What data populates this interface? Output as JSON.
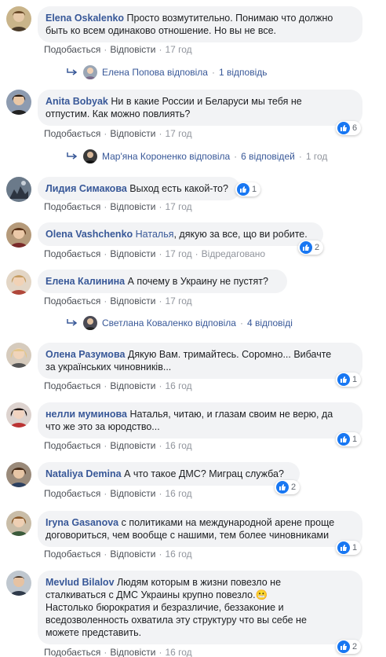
{
  "labels": {
    "like": "Подобається",
    "reply": "Відповісти",
    "edited": "Відредаговано"
  },
  "colors": {
    "link": "#385898",
    "bubble": "#f2f3f5",
    "like_badge": "#1877f2"
  },
  "comments": [
    {
      "author": "Elena Oskalenko",
      "lines": [
        "Просто возмутительно. Понимаю что должно",
        "быть ко всем одинаково отношение. Но вы не все."
      ],
      "time": "17 год",
      "avatar": "avatar-elena-oskalenko"
    },
    {
      "author": "Anita Bobyak",
      "lines": [
        "Ни в какие России и Беларуси мы тебя не",
        "отпустим. Как можно повлиять?"
      ],
      "time": "17 год",
      "reactions": "6",
      "avatar": "avatar-anita-bobyak"
    },
    {
      "author": "Лидия Симакова",
      "lines": [
        "Выход есть какой-то?"
      ],
      "time": "17 год",
      "reactions": "1",
      "avatar": "avatar-lidiya-simakova"
    },
    {
      "author": "Olena Vashchenko",
      "tag": "Наталья",
      "lines": [
        ", дякую за все, що ви робите."
      ],
      "time": "17 год",
      "edited": true,
      "reactions": "2",
      "avatar": "avatar-olena-vashchenko"
    },
    {
      "author": "Елена Калинина",
      "lines": [
        "А почему в Украину не пустят?"
      ],
      "time": "17 год",
      "avatar": "avatar-elena-kalinina"
    },
    {
      "author": "Олена Разумова",
      "lines": [
        "Дякую Вам. тримайтесь. Соромно... Вибачте",
        "за українських чиновників..."
      ],
      "time": "16 год",
      "reactions": "1",
      "avatar": "avatar-olena-razumova"
    },
    {
      "author": "нелли муминова",
      "lines": [
        "Наталья, читаю, и глазам своим не верю, да",
        "что же это за юродство..."
      ],
      "time": "16 год",
      "reactions": "1",
      "avatar": "avatar-nelli-muminova"
    },
    {
      "author": "Nataliya Demina",
      "lines": [
        "А что такое ДМС? Миграц служба?"
      ],
      "time": "16 год",
      "reactions": "2",
      "avatar": "avatar-nataliya-demina"
    },
    {
      "author": "Iryna Gasanova",
      "lines": [
        "с политиками на международной арене проще",
        "договориться, чем вообще с нашими, тем более чиновниками"
      ],
      "time": "16 год",
      "reactions": "1",
      "avatar": "avatar-iryna-gasanova"
    },
    {
      "author": "Mevlud Bilalov",
      "lines": [
        "Людям которым в жизни повезло не",
        "сталкиваться с ДМС Украины крупно повезло.😬",
        "Настолько бюрократия и безразличие, беззаконие и",
        "вседозволенность охватила эту структуру что вы себе не",
        "можете представить."
      ],
      "time": "16 год",
      "reactions": "2",
      "avatar": "avatar-mevlud-bilalov"
    }
  ],
  "reply_threads": [
    {
      "text": "Елена Попова відповіла",
      "count": "1 відповідь",
      "avatar": "avatar-elena-popova"
    },
    {
      "text": "Мар'яна Короненко відповіла",
      "count": "6 відповідей",
      "time": "1 год",
      "avatar": "avatar-maryana-koronenko"
    },
    {
      "text": "Светлана Коваленко відповіла",
      "count": "4 відповіді",
      "avatar": "avatar-svetlana-kovalenko"
    }
  ]
}
